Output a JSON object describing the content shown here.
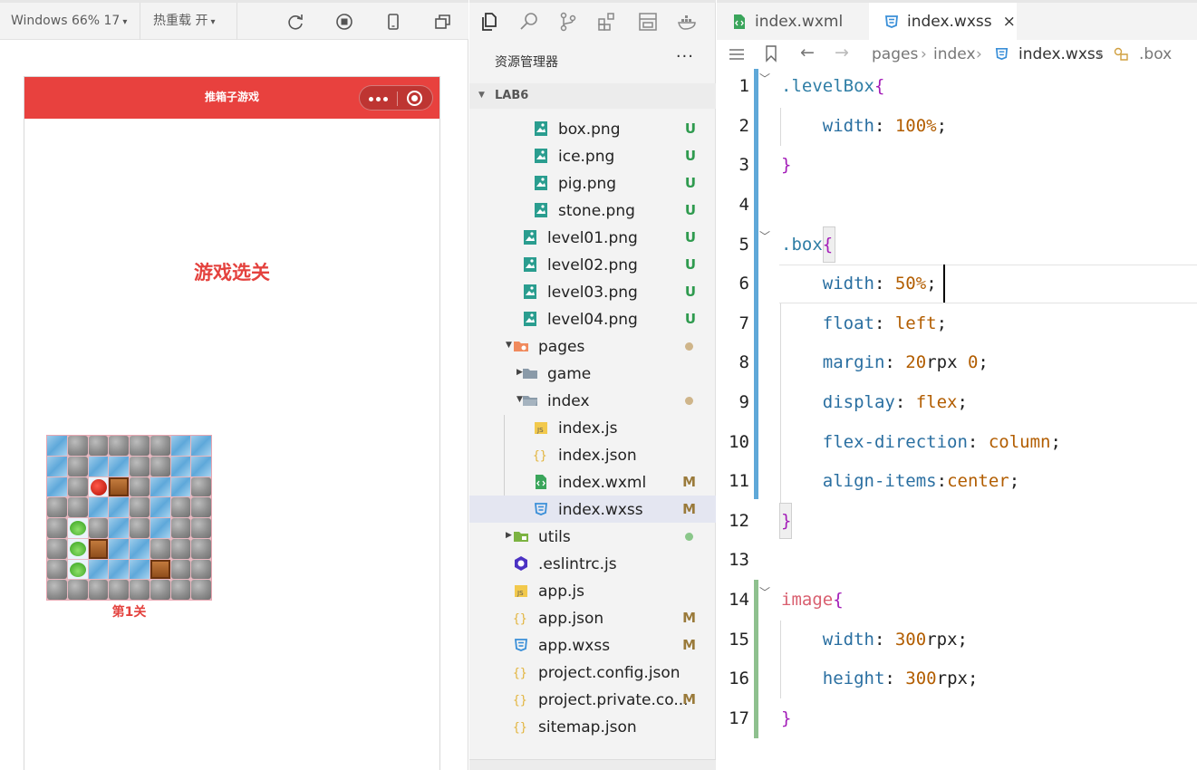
{
  "simulator": {
    "device": "Windows 66% 17",
    "hot_reload": "热重载 开",
    "nav_title": "推箱子游戏",
    "heading": "游戏选关",
    "level_label": "第1关"
  },
  "explorer": {
    "title": "资源管理器",
    "more": "···",
    "section": "LAB6",
    "rows": [
      {
        "label": "box.png",
        "status": "U",
        "icon": "image-file-icon"
      },
      {
        "label": "ice.png",
        "status": "U",
        "icon": "image-file-icon"
      },
      {
        "label": "pig.png",
        "status": "U",
        "icon": "image-file-icon"
      },
      {
        "label": "stone.png",
        "status": "U",
        "icon": "image-file-icon"
      },
      {
        "label": "level01.png",
        "status": "U",
        "icon": "image-file-icon"
      },
      {
        "label": "level02.png",
        "status": "U",
        "icon": "image-file-icon"
      },
      {
        "label": "level03.png",
        "status": "U",
        "icon": "image-file-icon"
      },
      {
        "label": "level04.png",
        "status": "U",
        "icon": "image-file-icon"
      },
      {
        "label": "pages",
        "status": "",
        "icon": "folder-icon"
      },
      {
        "label": "game",
        "status": "",
        "icon": "folder-icon"
      },
      {
        "label": "index",
        "status": "",
        "icon": "folder-icon"
      },
      {
        "label": "index.js",
        "status": "",
        "icon": "js-file-icon"
      },
      {
        "label": "index.json",
        "status": "",
        "icon": "json-file-icon"
      },
      {
        "label": "index.wxml",
        "status": "M",
        "icon": "wxml-file-icon"
      },
      {
        "label": "index.wxss",
        "status": "M",
        "icon": "css-file-icon"
      },
      {
        "label": "utils",
        "status": "",
        "icon": "folder-icon"
      },
      {
        "label": ".eslintrc.js",
        "status": "",
        "icon": "eslint-icon"
      },
      {
        "label": "app.js",
        "status": "",
        "icon": "js-file-icon"
      },
      {
        "label": "app.json",
        "status": "M",
        "icon": "json-file-icon"
      },
      {
        "label": "app.wxss",
        "status": "M",
        "icon": "css-file-icon"
      },
      {
        "label": "project.config.json",
        "status": "",
        "icon": "json-file-icon"
      },
      {
        "label": "project.private.co...",
        "status": "M",
        "icon": "json-file-icon"
      },
      {
        "label": "sitemap.json",
        "status": "",
        "icon": "json-file-icon"
      }
    ]
  },
  "editor": {
    "tabs": [
      {
        "label": "index.wxml",
        "active": false
      },
      {
        "label": "index.wxss",
        "active": true
      }
    ],
    "close": "×",
    "breadcrumb": [
      "pages",
      "index",
      "index.wxss",
      ".box"
    ],
    "line_numbers": [
      "1",
      "2",
      "3",
      "4",
      "5",
      "6",
      "7",
      "8",
      "9",
      "10",
      "11",
      "12",
      "13",
      "14",
      "15",
      "16",
      "17"
    ]
  },
  "colors": {
    "nav_red": "#e8413e",
    "untracked_green": "#2e9a4e",
    "modified_brown": "#9a7a3a",
    "selection_bg": "#e4e6f1"
  }
}
